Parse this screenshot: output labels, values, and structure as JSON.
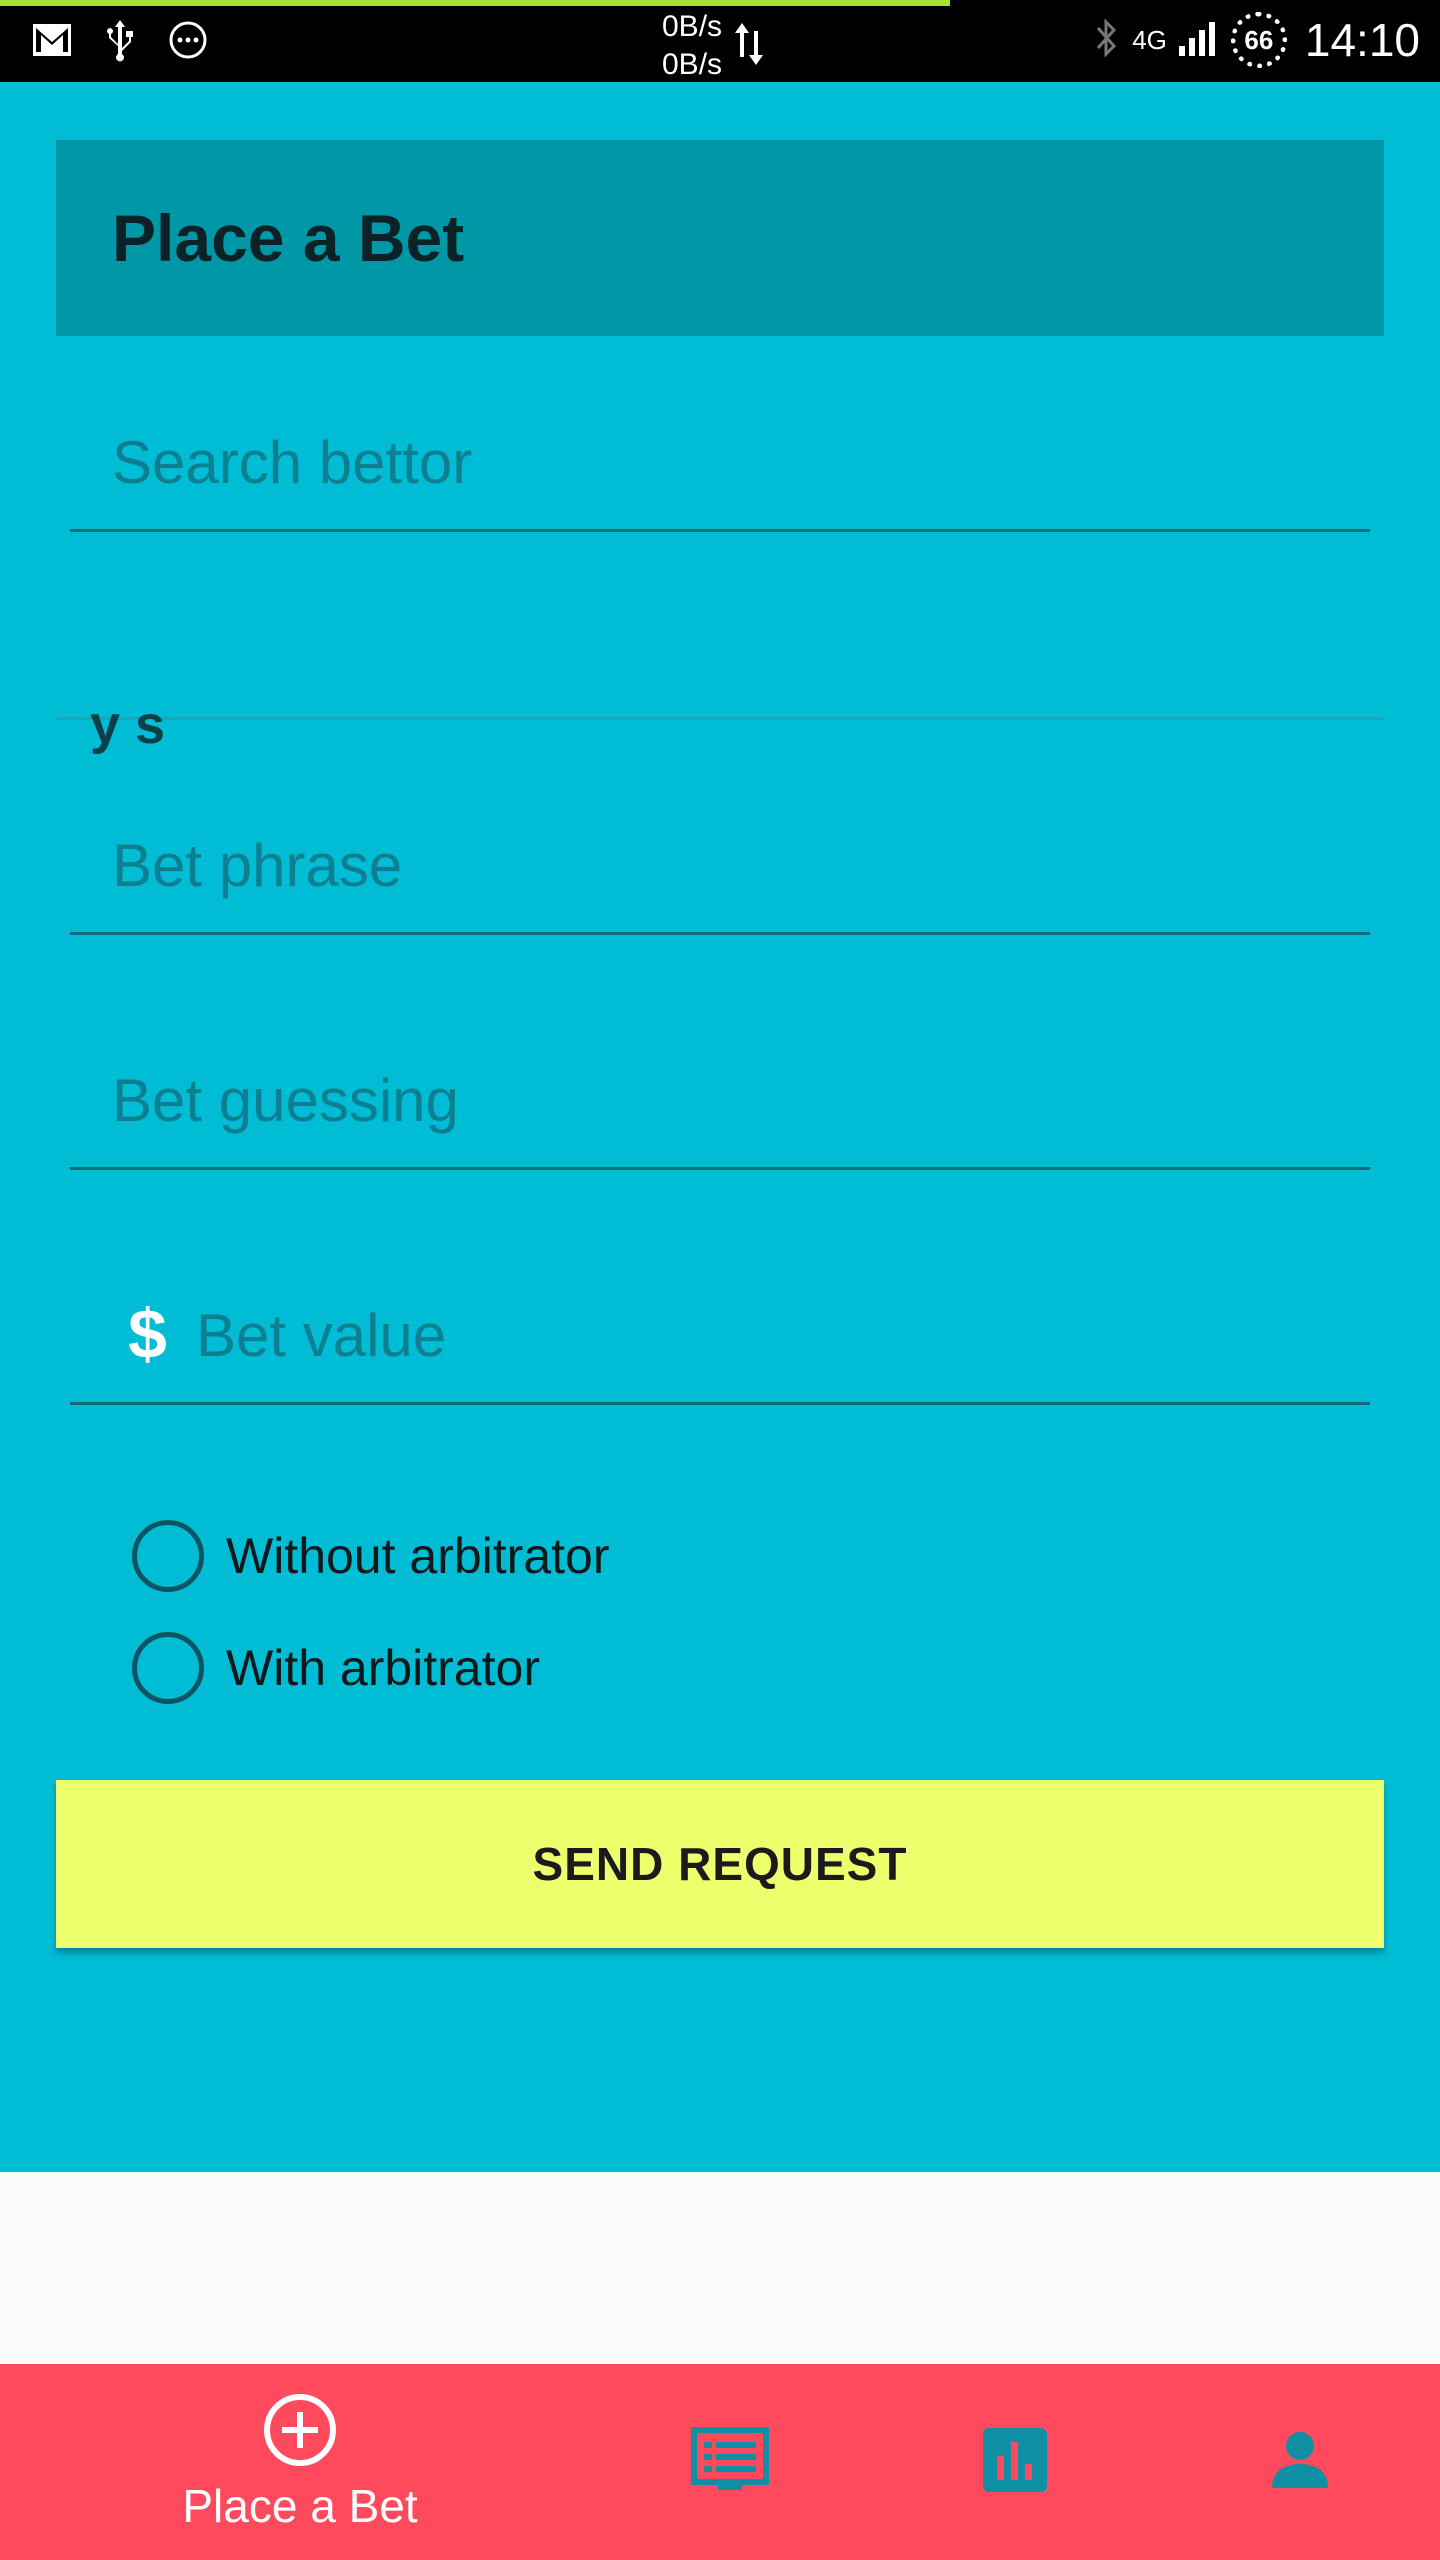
{
  "status_bar": {
    "net_rate_up": "0B/s",
    "net_rate_down": "0B/s",
    "network_type": "4G",
    "battery_level": "66",
    "time": "14:10",
    "icons": [
      "gmail-icon",
      "usb-icon",
      "more-icon",
      "data-transfer-icon",
      "bluetooth-icon",
      "signal-icon"
    ]
  },
  "header": {
    "title": "Place a Bet"
  },
  "form": {
    "search_placeholder": "Search bettor",
    "selected_bettor": "y s",
    "phrase_placeholder": "Bet phrase",
    "guessing_placeholder": "Bet guessing",
    "value_placeholder": "Bet value",
    "currency_symbol": "$",
    "arbitrator_options": [
      {
        "label": "Without arbitrator",
        "selected": false
      },
      {
        "label": "With arbitrator",
        "selected": false
      }
    ],
    "submit_label": "SEND REQUEST"
  },
  "bottom_nav": {
    "items": [
      {
        "label": "Place a Bet",
        "icon": "add-circle-icon",
        "active": true
      },
      {
        "label": "",
        "icon": "bets-list-icon",
        "active": false
      },
      {
        "label": "",
        "icon": "stats-chart-icon",
        "active": false
      },
      {
        "label": "",
        "icon": "profile-icon",
        "active": false
      }
    ]
  },
  "colors": {
    "content_bg": "#00bcd4",
    "header_bg": "#0097a7",
    "button_bg": "#eeff6e",
    "nav_bg": "#ff4a5e",
    "nav_icon_inactive": "#0e8fa3"
  }
}
